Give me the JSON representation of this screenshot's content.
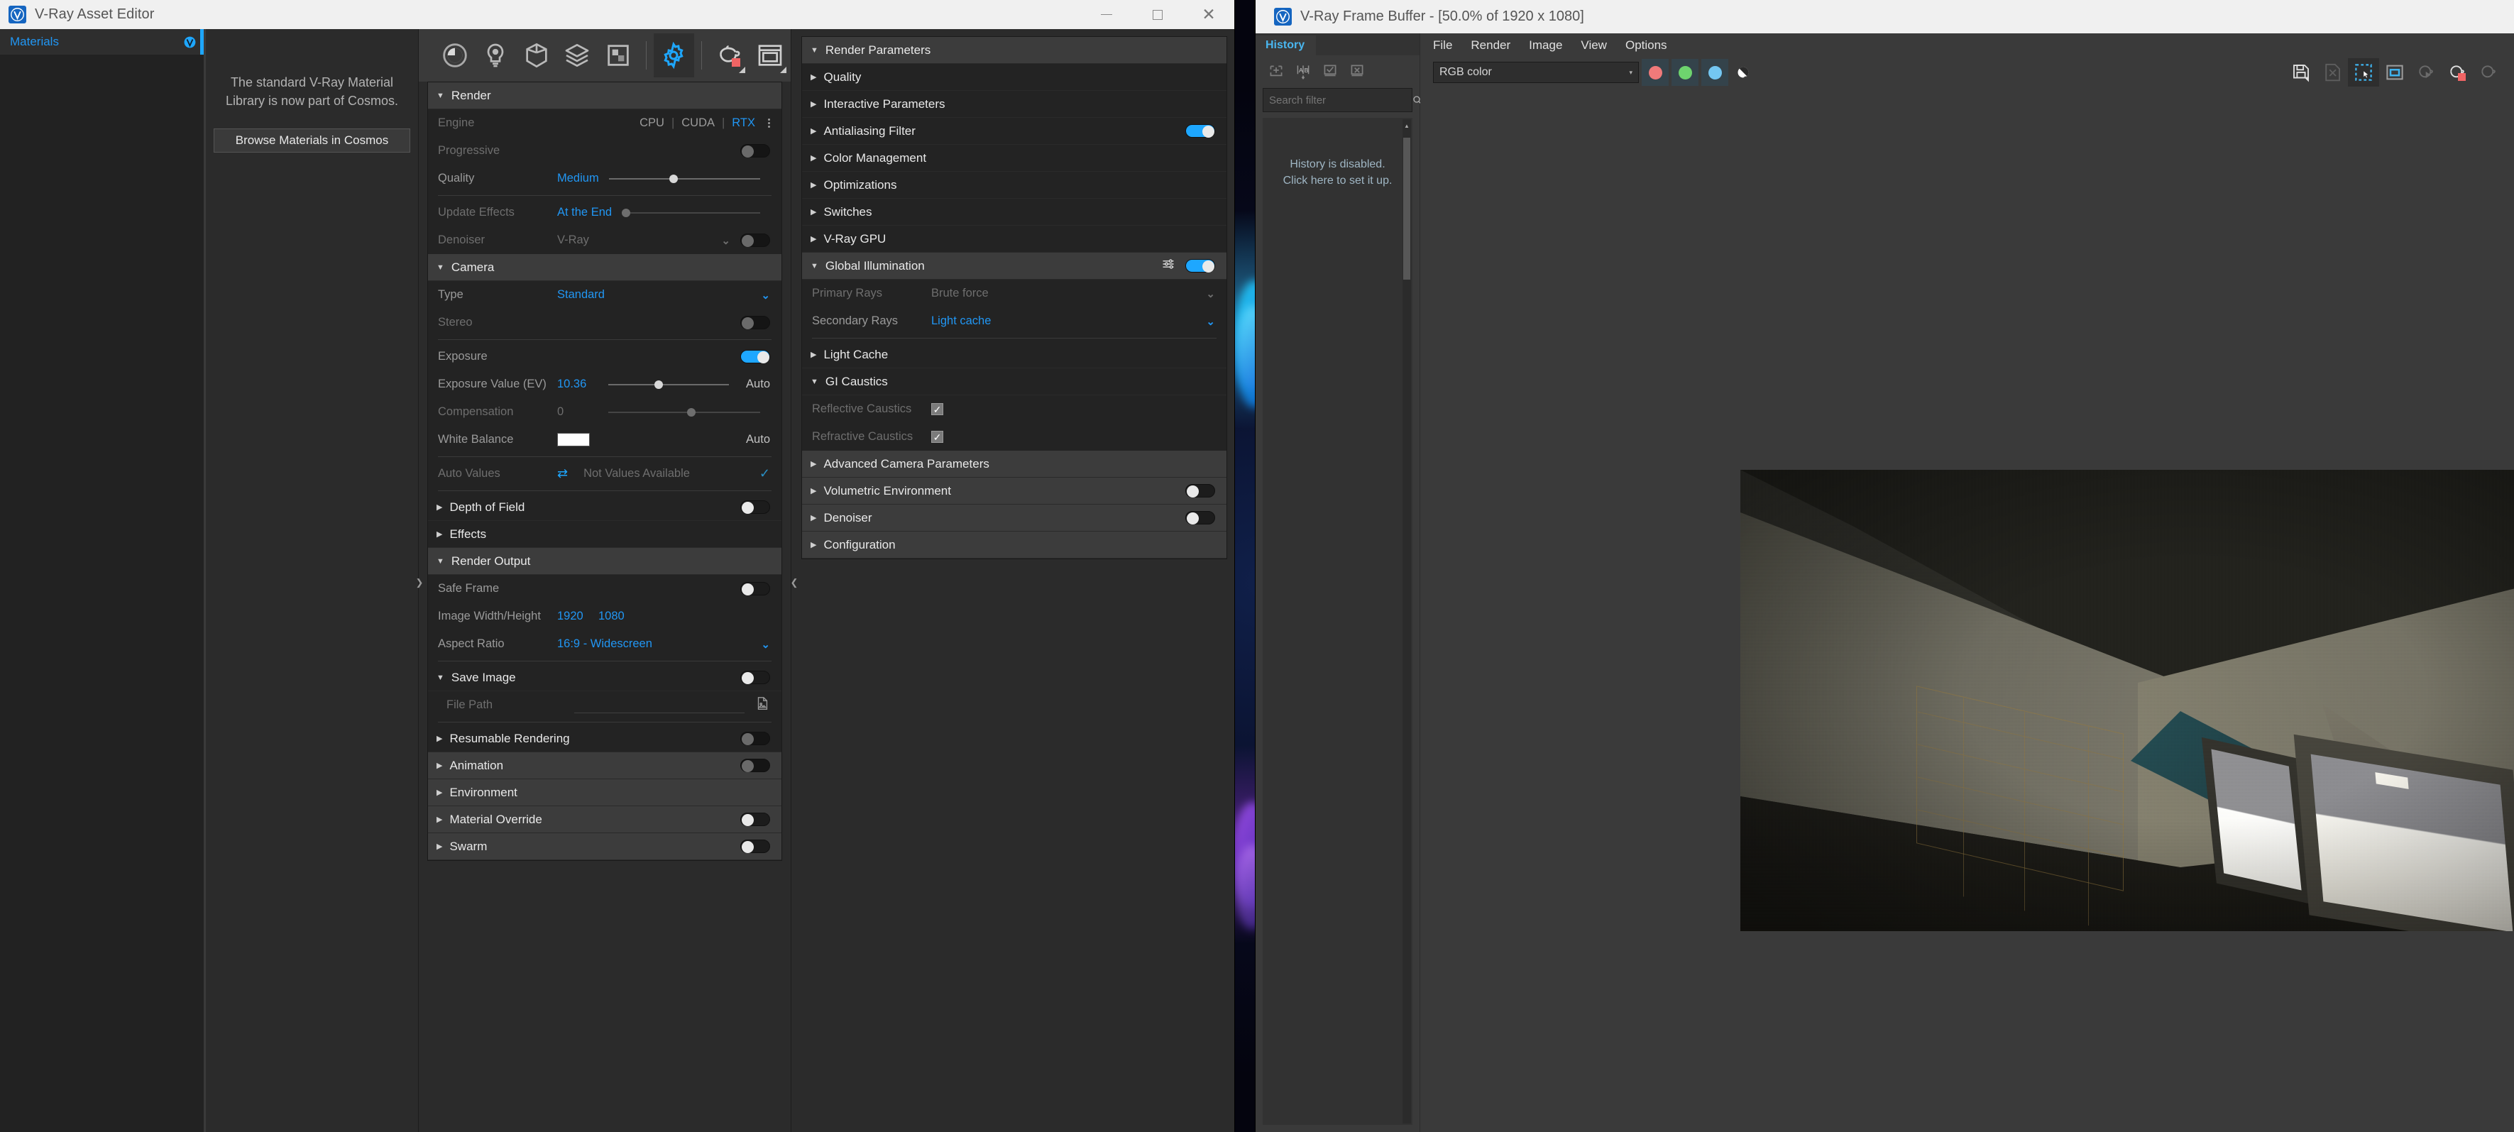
{
  "asset_editor": {
    "title": "V-Ray Asset Editor",
    "window_buttons": {
      "minimize": "—",
      "maximize": "▢",
      "close": "✕"
    },
    "tree": {
      "tab_label": "Materials"
    },
    "promo": {
      "text": "The standard V-Ray Material Library is now part of Cosmos.",
      "button_label": "Browse Materials in Cosmos"
    },
    "toolbar_icons": [
      "materials-icon",
      "lights-icon",
      "geometry-icon",
      "textures-icon",
      "render-elements-icon",
      "settings-gear-icon",
      "render-teapot-icon",
      "frame-buffer-icon"
    ],
    "sections": {
      "render": {
        "title": "Render",
        "engine": {
          "label": "Engine",
          "options": [
            "CPU",
            "CUDA",
            "RTX"
          ],
          "selected": "RTX"
        },
        "progressive": {
          "label": "Progressive",
          "value": "off"
        },
        "quality": {
          "label": "Quality",
          "value": "Medium",
          "slider_pct": 40
        },
        "update_effects": {
          "label": "Update Effects",
          "value": "At the End",
          "slider_pct": 0
        },
        "denoiser": {
          "label": "Denoiser",
          "value": "V-Ray",
          "toggle": "off"
        }
      },
      "camera": {
        "title": "Camera",
        "type": {
          "label": "Type",
          "value": "Standard"
        },
        "stereo": {
          "label": "Stereo",
          "value": "off"
        },
        "exposure": {
          "label": "Exposure",
          "value": "on"
        },
        "exposure_value": {
          "label": "Exposure Value (EV)",
          "value": "10.36",
          "slider_pct": 38,
          "auto": "Auto"
        },
        "compensation": {
          "label": "Compensation",
          "value": "0",
          "slider_pct": 52
        },
        "white_balance": {
          "label": "White Balance",
          "color": "#ffffff",
          "auto": "Auto"
        },
        "auto_values": {
          "label": "Auto Values",
          "status": "Not Values Available"
        },
        "depth_of_field": {
          "label": "Depth of Field",
          "value": "off"
        },
        "effects": {
          "label": "Effects"
        }
      },
      "render_output": {
        "title": "Render Output",
        "safe_frame": {
          "label": "Safe Frame",
          "value": "off"
        },
        "image_size": {
          "label": "Image Width/Height",
          "width": "1920",
          "height": "1080"
        },
        "aspect_ratio": {
          "label": "Aspect Ratio",
          "value": "16:9 - Widescreen"
        },
        "save_image": {
          "label": "Save Image",
          "value": "off"
        },
        "file_path": {
          "label": "File Path",
          "placeholder": "File Path",
          "value": ""
        },
        "resumable_rendering": {
          "label": "Resumable Rendering",
          "value": "off"
        },
        "animation": {
          "label": "Animation",
          "value": "off"
        },
        "environment": {
          "label": "Environment"
        },
        "material_override": {
          "label": "Material Override",
          "value": "off"
        },
        "swarm": {
          "label": "Swarm",
          "value": "off"
        }
      }
    },
    "footer_icons": [
      "open-folder-icon",
      "layout-icon",
      "grid-icon",
      "teapot-render-icon",
      "teapot-add-icon",
      "open-scene-icon",
      "save-scene-icon",
      "revert-icon"
    ]
  },
  "render_parameters": {
    "title": "Render Parameters",
    "items": [
      {
        "label": "Quality",
        "toggle": null,
        "expanded": false
      },
      {
        "label": "Interactive Parameters",
        "toggle": null,
        "expanded": false
      },
      {
        "label": "Antialiasing Filter",
        "toggle": "on",
        "expanded": false
      },
      {
        "label": "Color Management",
        "toggle": null,
        "expanded": false
      },
      {
        "label": "Optimizations",
        "toggle": null,
        "expanded": false
      },
      {
        "label": "Switches",
        "toggle": null,
        "expanded": false
      },
      {
        "label": "V-Ray GPU",
        "toggle": null,
        "expanded": false
      }
    ],
    "global_illumination": {
      "label": "Global Illumination",
      "toggle": "on",
      "expanded": true,
      "primary_rays": {
        "label": "Primary Rays",
        "value": "Brute force"
      },
      "secondary_rays": {
        "label": "Secondary Rays",
        "value": "Light cache"
      }
    },
    "light_cache": {
      "label": "Light Cache"
    },
    "gi_caustics": {
      "label": "GI Caustics",
      "reflective": {
        "label": "Reflective Caustics",
        "checked": true
      },
      "refractive": {
        "label": "Refractive Caustics",
        "checked": true
      }
    },
    "tail_items": [
      {
        "label": "Advanced Camera Parameters",
        "toggle": null
      },
      {
        "label": "Volumetric Environment",
        "toggle": "off"
      },
      {
        "label": "Denoiser",
        "toggle": "off"
      },
      {
        "label": "Configuration",
        "toggle": null
      }
    ]
  },
  "frame_buffer": {
    "title": "V-Ray Frame Buffer - [50.0% of 1920 x 1080]",
    "menus": [
      "File",
      "Render",
      "Image",
      "View",
      "Options"
    ],
    "channel_select": {
      "value": "RGB color"
    },
    "color_buttons": [
      {
        "name": "red-channel-button",
        "color": "#f07a7a"
      },
      {
        "name": "green-channel-button",
        "color": "#6ed46e"
      },
      {
        "name": "blue-channel-button",
        "color": "#74c7f2"
      }
    ],
    "alpha_button": "alpha-channel-icon",
    "right_tools": [
      {
        "name": "save-image-icon",
        "state": "enabled"
      },
      {
        "name": "clear-image-icon",
        "state": "disabled"
      },
      {
        "name": "region-select-icon",
        "state": "selected"
      },
      {
        "name": "fit-to-window-icon",
        "state": "enabled"
      },
      {
        "name": "render-last-icon",
        "state": "disabled"
      },
      {
        "name": "render-stop-icon",
        "state": "enabled"
      },
      {
        "name": "render-icon",
        "state": "disabled"
      }
    ],
    "history": {
      "tab_label": "History",
      "buttons": [
        "history-add-icon",
        "history-compare-ab-icon",
        "history-load-icon",
        "history-delete-icon"
      ],
      "search_placeholder": "Search filter",
      "message_line1": "History is disabled.",
      "message_line2": "Click here to set it up."
    },
    "render_view": {
      "description": "Interior room render: concrete walls, dark stone floor, two bright sunlit window openings on right wall, caustic light triangles on floor, faint brick outline pattern on left wall",
      "zoom": "50.0%",
      "resolution": "1920 x 1080"
    }
  }
}
